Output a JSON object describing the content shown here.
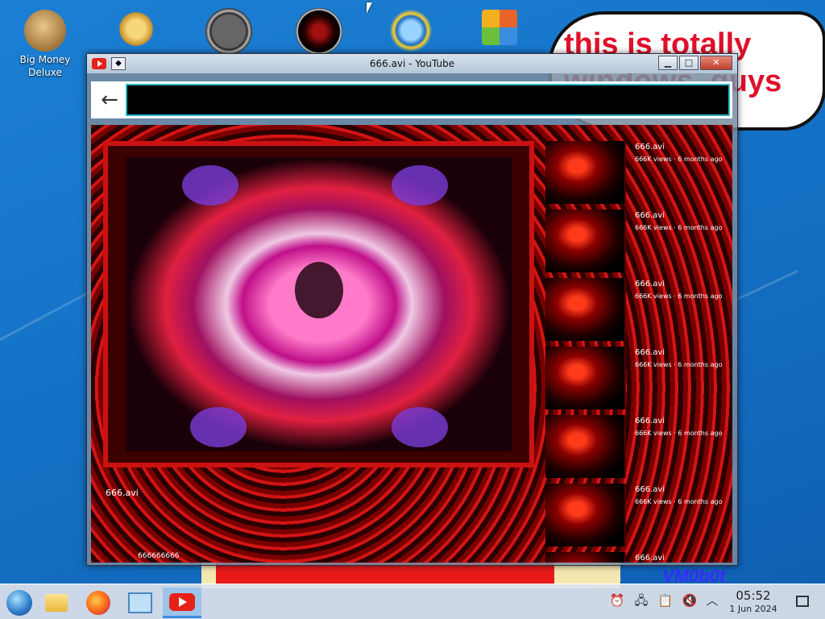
{
  "desktop": {
    "icons": [
      {
        "label": "Big Money\nDeluxe",
        "icon": "money-bag-icon"
      },
      {
        "label": "",
        "icon": "gear-icon"
      },
      {
        "label": "",
        "icon": "speedometer-icon"
      },
      {
        "label": "",
        "icon": "dark-orb-icon"
      },
      {
        "label": "",
        "icon": "globe-sun-icon"
      },
      {
        "label": "",
        "icon": "office-icon"
      }
    ],
    "bubble_text": "this is totally\nwindows, guys",
    "signature": "VM0b0t"
  },
  "window": {
    "title": "666.avi - YouTube",
    "controls": {
      "minimize": "▁",
      "maximize": "□",
      "close": "✕"
    },
    "url": ""
  },
  "video": {
    "title": "666.avi",
    "channel": "666666666"
  },
  "related": [
    {
      "title": "666.avi",
      "meta": "666K views · 6 months ago"
    },
    {
      "title": "666.avi",
      "meta": "666K views · 6 months ago"
    },
    {
      "title": "666.avi",
      "meta": "666K views · 6 months ago"
    },
    {
      "title": "666.avi",
      "meta": "666K views · 6 months ago"
    },
    {
      "title": "666.avi",
      "meta": "666K views · 6 months ago"
    },
    {
      "title": "666.avi",
      "meta": "666K views · 6 months ago"
    },
    {
      "title": "666.avi",
      "meta": ""
    }
  ],
  "taskbar": {
    "items": [
      "start-orb",
      "file-explorer",
      "firefox",
      "control-panel",
      "youtube"
    ],
    "tray": [
      "alarm-icon",
      "network-icon",
      "clipboard-icon",
      "volume-muted-icon",
      "chevron-up-icon"
    ],
    "time": "05:52",
    "date": "1 Jun 2024"
  },
  "colors": {
    "accent": "#2ab7c4",
    "youtube_red": "#e62117",
    "bubble_text": "#e0102a"
  }
}
